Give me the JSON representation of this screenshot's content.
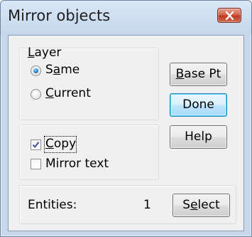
{
  "window": {
    "title": "Mirror objects",
    "close_icon": "close-x-icon"
  },
  "layer_group": {
    "label_pre": "",
    "label_mnemonic": "L",
    "label_post": "ayer",
    "options": [
      {
        "pre": "S",
        "mnemonic": "a",
        "post": "me",
        "checked": true
      },
      {
        "pre": "",
        "mnemonic": "C",
        "post": "urrent",
        "checked": false
      }
    ]
  },
  "options_group": {
    "copy": {
      "pre": "",
      "mnemonic": "C",
      "post": "opy",
      "checked": true
    },
    "mirror_text": {
      "label": "Mirror text",
      "checked": false
    }
  },
  "entities": {
    "label": "Entities:",
    "count": "1"
  },
  "buttons": {
    "base_pt": {
      "pre": "",
      "mnemonic": "B",
      "post": "ase Pt"
    },
    "done": {
      "label": "Done"
    },
    "help": {
      "label": "Help"
    },
    "select": {
      "pre": "S",
      "mnemonic": "e",
      "post": "lect"
    }
  },
  "colors": {
    "frame": "#c7d8ec",
    "close_button": "#c9432c",
    "default_button_border": "#3c7fb1",
    "radio_dot": "#2a7fc9"
  }
}
